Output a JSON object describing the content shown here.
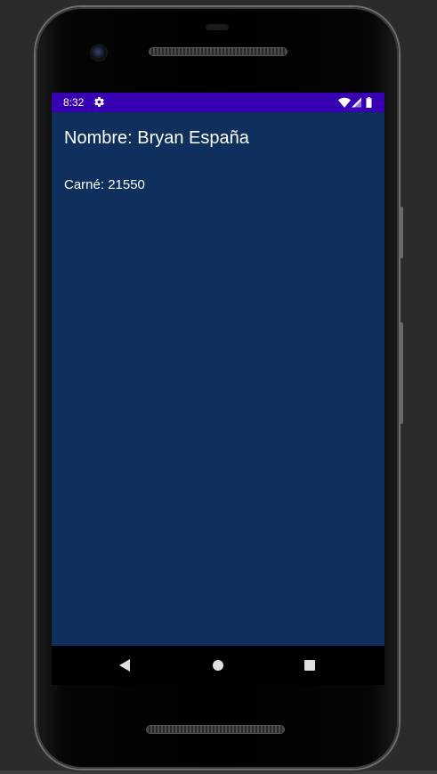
{
  "status_bar": {
    "time": "8:32",
    "settings_icon": "gear-icon",
    "wifi_icon": "wifi-icon",
    "signal_icon": "cell-signal-icon",
    "battery_icon": "battery-icon",
    "background_color": "#3700b3"
  },
  "main": {
    "title": "Nombre: Bryan España",
    "subtitle": "Carné: 21550",
    "background_color": "#0f2f5c"
  },
  "nav_bar": {
    "back_icon": "back-triangle-icon",
    "home_icon": "home-circle-icon",
    "recents_icon": "recents-square-icon"
  }
}
